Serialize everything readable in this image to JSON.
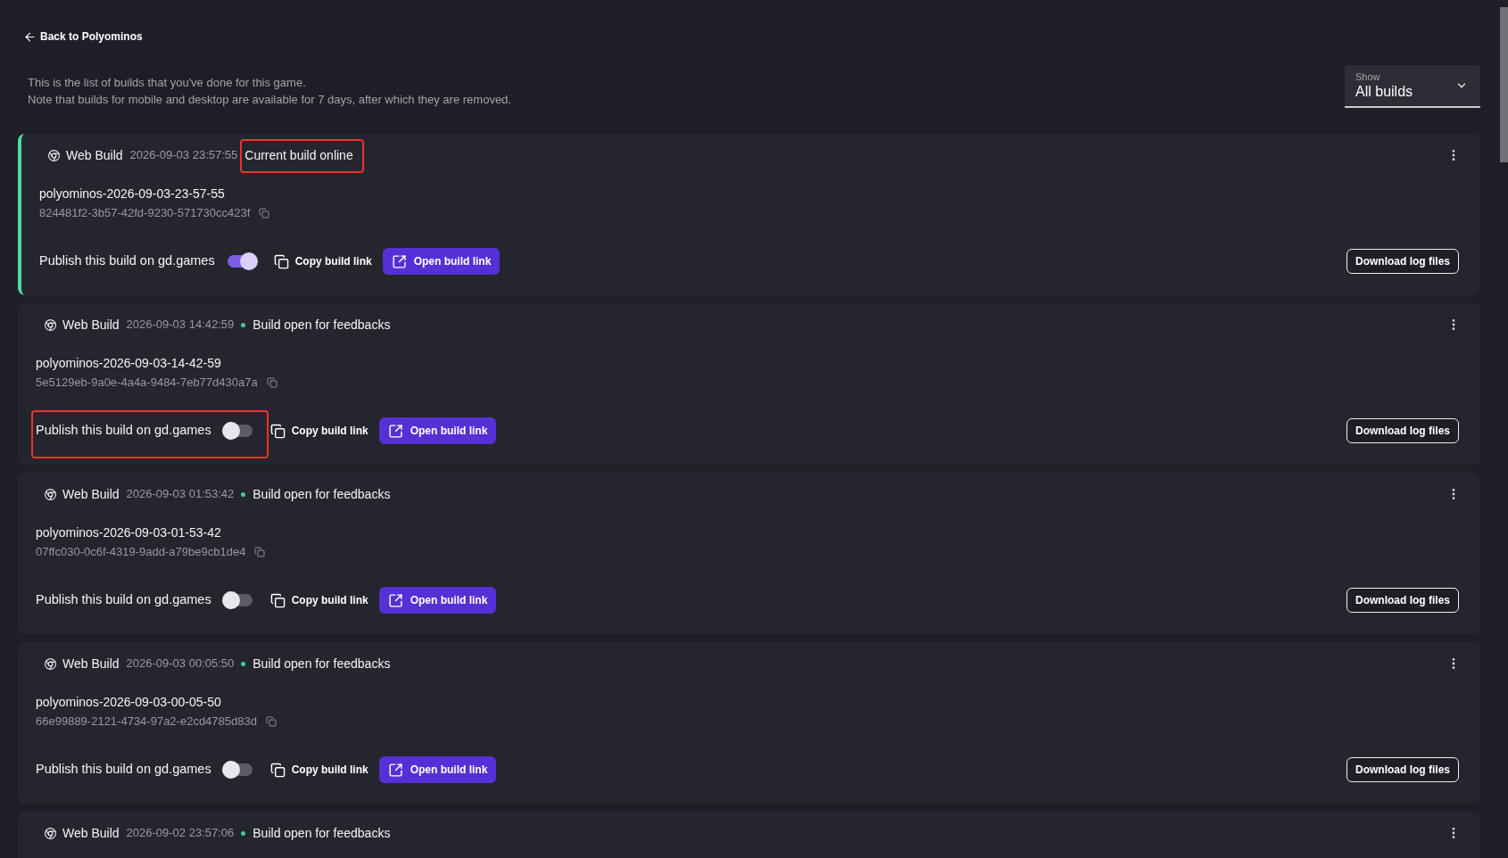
{
  "back_link": {
    "label": "Back to Polyominos"
  },
  "description": [
    "This is the list of builds that you've done for this game.",
    "Note that builds for mobile and desktop are available for 7 days, after which they are removed."
  ],
  "filter": {
    "label": "Show",
    "value": "All builds"
  },
  "builds": [
    {
      "current": true,
      "type": "Web Build",
      "date": "2026-09-03 23:57:55",
      "status": {
        "label": "Current build online",
        "highlighted": true
      },
      "name": "polyominos-2026-09-03-23-57-55",
      "id": "824481f2-3b57-42fd-9230-571730cc423f",
      "publish": {
        "label": "Publish this build on gd.games",
        "on": true,
        "highlighted": false
      },
      "copy_link": "Copy build link",
      "open_link": "Open build link",
      "download_logs": "Download log files"
    },
    {
      "current": false,
      "type": "Web Build",
      "date": "2026-09-03 14:42:59",
      "status": {
        "label": "Build open for feedbacks",
        "highlighted": false
      },
      "name": "polyominos-2026-09-03-14-42-59",
      "id": "5e5129eb-9a0e-4a4a-9484-7eb77d430a7a",
      "publish": {
        "label": "Publish this build on gd.games",
        "on": false,
        "highlighted": true
      },
      "copy_link": "Copy build link",
      "open_link": "Open build link",
      "download_logs": "Download log files"
    },
    {
      "current": false,
      "type": "Web Build",
      "date": "2026-09-03 01:53:42",
      "status": {
        "label": "Build open for feedbacks",
        "highlighted": false
      },
      "name": "polyominos-2026-09-03-01-53-42",
      "id": "07ffc030-0c6f-4319-9add-a79be9cb1de4",
      "publish": {
        "label": "Publish this build on gd.games",
        "on": false,
        "highlighted": false
      },
      "copy_link": "Copy build link",
      "open_link": "Open build link",
      "download_logs": "Download log files"
    },
    {
      "current": false,
      "type": "Web Build",
      "date": "2026-09-03 00:05:50",
      "status": {
        "label": "Build open for feedbacks",
        "highlighted": false
      },
      "name": "polyominos-2026-09-03-00-05-50",
      "id": "66e99889-2121-4734-97a2-e2cd4785d83d",
      "publish": {
        "label": "Publish this build on gd.games",
        "on": false,
        "highlighted": false
      },
      "copy_link": "Copy build link",
      "open_link": "Open build link",
      "download_logs": "Download log files"
    },
    {
      "current": false,
      "type": "Web Build",
      "date": "2026-09-02 23:57:06",
      "status": {
        "label": "Build open for feedbacks",
        "highlighted": false
      }
    }
  ]
}
